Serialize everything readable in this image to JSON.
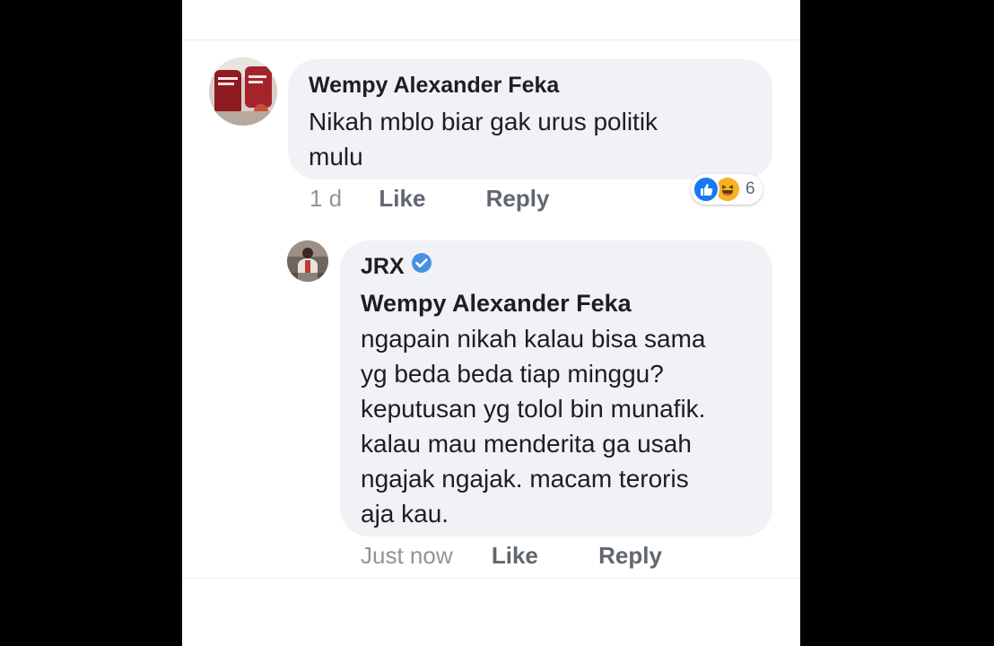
{
  "colors": {
    "page_background": "#000000",
    "panel_background": "#ffffff",
    "bubble_background": "#f0f2f5",
    "text": "#1c1e21",
    "meta_text": "#90949c",
    "action_text": "#606770",
    "like_blue": "#1877f2",
    "haha_yellow": "#f7b125",
    "verified_blue": "#4a90e2"
  },
  "comment": {
    "author": "Wempy Alexander Feka",
    "avatar_icon": "profile-photo",
    "body_lines": [
      "Nikah mblo biar gak urus politik",
      "mulu"
    ],
    "time": "1 d",
    "like_label": "Like",
    "reply_label": "Reply",
    "reactions": {
      "icons": [
        "like-icon",
        "haha-icon"
      ],
      "count": "6"
    }
  },
  "reply": {
    "author": "JRX",
    "verified_icon": "verified-badge-icon",
    "mention": "Wempy Alexander Feka",
    "avatar_icon": "profile-photo",
    "body_lines": [
      "ngapain nikah kalau bisa sama",
      "yg beda beda tiap minggu?",
      "keputusan yg tolol bin munafik.",
      "kalau mau menderita ga usah",
      "ngajak ngajak. macam teroris",
      "aja kau."
    ],
    "time": "Just now",
    "like_label": "Like",
    "reply_label": "Reply"
  }
}
